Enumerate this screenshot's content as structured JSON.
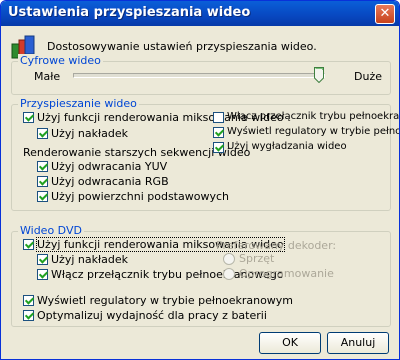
{
  "window": {
    "title": "Ustawienia przyspieszania wideo"
  },
  "header": {
    "description": "Dostosowywanie ustawień przyspieszania wideo."
  },
  "digital_video": {
    "legend": "Cyfrowe wideo",
    "min_label": "Małe",
    "max_label": "Duże",
    "level_percent": 100
  },
  "acceleration": {
    "legend": "Przyspieszanie wideo",
    "use_mixing_render": {
      "label": "Użyj funkcji renderowania miksowania wideo",
      "checked": true
    },
    "use_overlays": {
      "label": "Użyj nakładek",
      "checked": true
    },
    "legacy_heading": "Renderowanie starszych sekwencji wideo",
    "use_yuv_flip": {
      "label": "Użyj odwracania YUV",
      "checked": true
    },
    "use_rgb_flip": {
      "label": "Użyj odwracania RGB",
      "checked": true
    },
    "use_primary_surfaces": {
      "label": "Użyj powierzchni podstawowych",
      "checked": true
    },
    "fullscreen_switch": {
      "label": "Włącz przełącznik trybu pełnoekranowego",
      "checked": false
    },
    "show_controls_fullscreen": {
      "label": "Wyświetl regulatory w trybie pełnoekranowym",
      "checked": true
    },
    "use_smoothing": {
      "label": "Użyj wygładzania wideo",
      "checked": true
    }
  },
  "dvd": {
    "legend": "Wideo DVD",
    "use_mixing_render": {
      "label": "Użyj funkcji renderowania miksowania wideo",
      "checked": true
    },
    "use_overlays": {
      "label": "Użyj nakładek",
      "checked": true
    },
    "fullscreen_switch": {
      "label": "Włącz przełącznik trybu pełnoekranowego",
      "checked": true
    },
    "preferred_decoder": "Preferowany dekoder:",
    "decoder_hardware": "Sprzęt",
    "decoder_software": "Oprogramowanie",
    "show_controls_fullscreen": {
      "label": "Wyświetl regulatory w trybie pełnoekranowym",
      "checked": true
    },
    "optimize_battery": {
      "label": "Optymalizuj wydajność dla pracy z baterii",
      "checked": true
    }
  },
  "buttons": {
    "ok": "OK",
    "cancel": "Anuluj"
  },
  "colors": {
    "titlebar": "#0847c0",
    "legend_text": "#0046d5",
    "dialog_bg": "#ece9d8"
  }
}
